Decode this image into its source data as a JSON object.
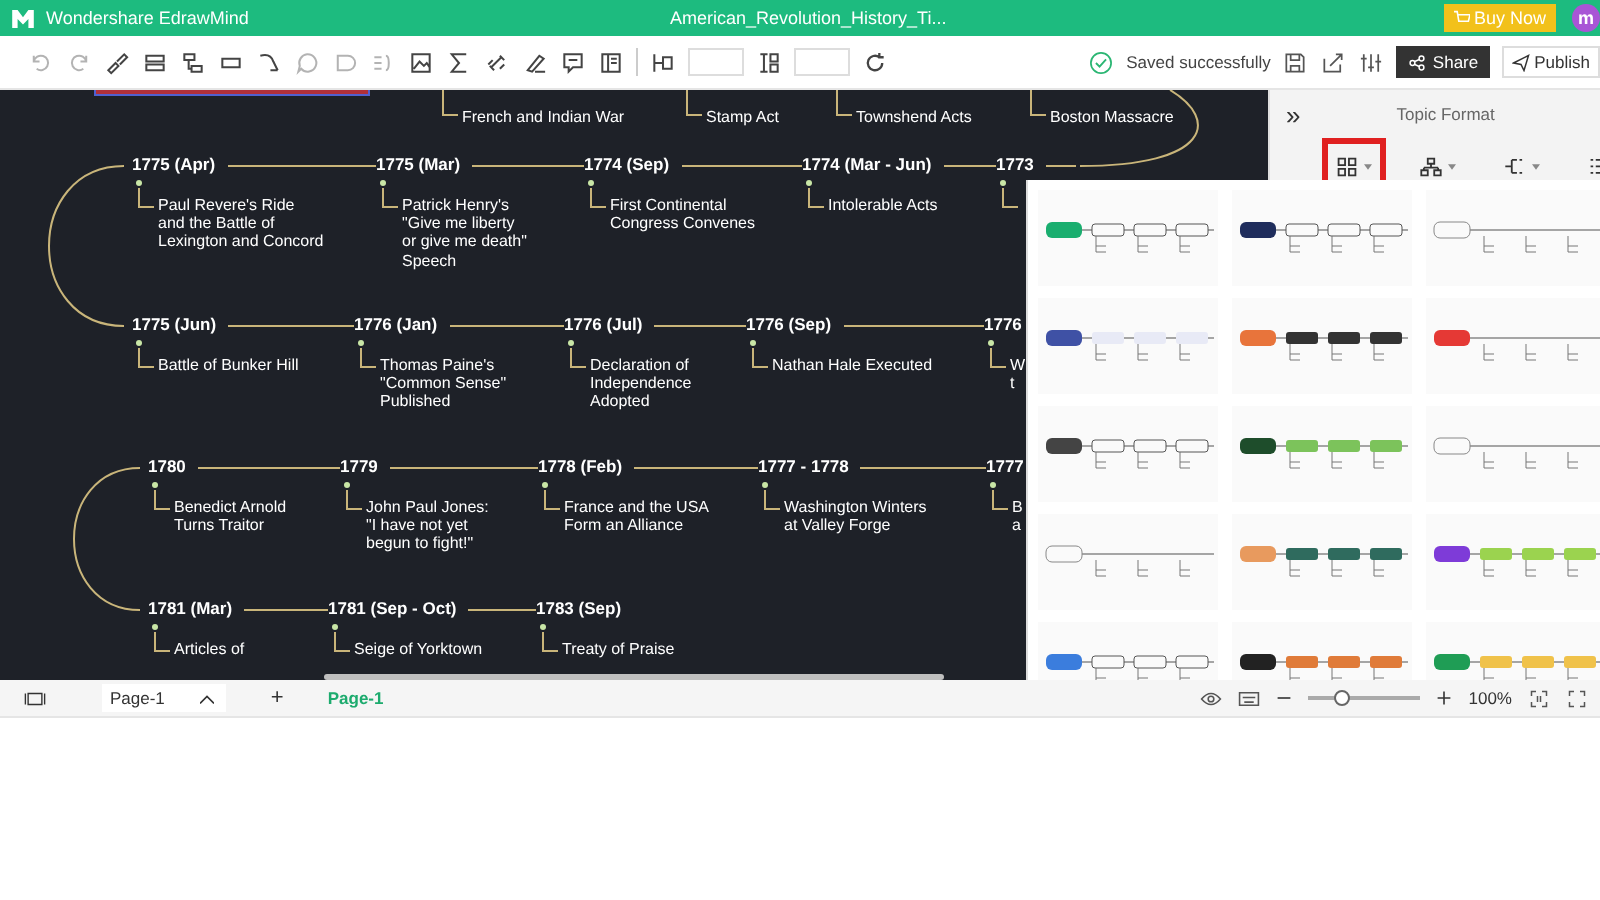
{
  "app": {
    "name": "Wondershare EdrawMind",
    "document_title": "American_Revolution_History_Ti...",
    "buy_button": "Buy Now",
    "avatar": "m"
  },
  "toolbar": {
    "save_status": "Saved successfully",
    "share": "Share",
    "publish": "Publish"
  },
  "canvas": {
    "top_topics": [
      "French and Indian War",
      "Stamp Act",
      "Townshend Acts",
      "Boston Massacre"
    ],
    "rows": [
      {
        "nodes": [
          {
            "date": "1775 (Apr)",
            "topic": "Paul Revere's Ride\nand the Battle of\nLexington and Concord"
          },
          {
            "date": "1775 (Mar)",
            "topic": "Patrick Henry's\n\"Give me liberty\nor give me death\"\nSpeech"
          },
          {
            "date": "1774 (Sep)",
            "topic": "First Continental\nCongress Convenes"
          },
          {
            "date": "1774 (Mar - Jun)",
            "topic": "Intolerable Acts"
          },
          {
            "date": "1773"
          }
        ]
      },
      {
        "nodes": [
          {
            "date": "1775 (Jun)",
            "topic": "Battle of Bunker Hill"
          },
          {
            "date": "1776 (Jan)",
            "topic": "Thomas Paine's\n\"Common Sense\"\nPublished"
          },
          {
            "date": "1776 (Jul)",
            "topic": "Declaration of\nIndependence\nAdopted"
          },
          {
            "date": "1776 (Sep)",
            "topic": "Nathan Hale Executed"
          },
          {
            "date": "1776",
            "topic": "W\nt"
          }
        ]
      },
      {
        "nodes": [
          {
            "date": "1780",
            "topic": "Benedict Arnold\nTurns Traitor"
          },
          {
            "date": "1779",
            "topic": "John Paul Jones:\n\"I have not yet\nbegun to fight!\""
          },
          {
            "date": "1778 (Feb)",
            "topic": "France and the USA\nForm an Alliance"
          },
          {
            "date": "1777 - 1778",
            "topic": "Washington Winters\nat Valley Forge"
          },
          {
            "date": "1777",
            "topic": "B\na"
          }
        ]
      },
      {
        "nodes": [
          {
            "date": "1781 (Mar)",
            "topic": "Articles of"
          },
          {
            "date": "1781 (Sep - Oct)",
            "topic": "Seige of Yorktown"
          },
          {
            "date": "1783 (Sep)",
            "topic": "Treaty of Praise"
          }
        ]
      }
    ]
  },
  "panel": {
    "collapse": "»",
    "title": "Topic Format",
    "tools": [
      {
        "selected": true
      },
      {
        "selected": false
      },
      {
        "selected": false
      },
      {
        "selected": false
      }
    ]
  },
  "templates": [
    {
      "kind": "outline",
      "color": "#1aae6f"
    },
    {
      "kind": "outline",
      "color": "#1f2d5c"
    },
    {
      "kind": "plain"
    },
    {
      "kind": "filled",
      "color": "#3f51a5",
      "topic": {
        "color": "#e8eaf6"
      }
    },
    {
      "kind": "filled",
      "color": "#e8743b",
      "topic": {
        "color": "#333333"
      }
    },
    {
      "kind": "plain",
      "color": "#e53935"
    },
    {
      "kind": "outline",
      "color": "#444444"
    },
    {
      "kind": "filled",
      "color": "#1e4d2b",
      "topic": {
        "color": "#7cc35b"
      }
    },
    {
      "kind": "plain"
    },
    {
      "kind": "plain"
    },
    {
      "kind": "filled",
      "color": "#e89a5e",
      "topic": {
        "color": "#2f6b5e"
      }
    },
    {
      "kind": "filled",
      "color": "#7e3bd8",
      "topic": {
        "color": "#9bd34f"
      }
    },
    {
      "kind": "outline",
      "color": "#3b7ddd"
    },
    {
      "kind": "filled",
      "color": "#222222",
      "topic": {
        "color": "#e07b39"
      }
    },
    {
      "kind": "filled",
      "color": "#1f9d55",
      "topic": {
        "color": "#f0c24a"
      }
    }
  ],
  "status_bar": {
    "page_select": "Page-1",
    "add": "+",
    "pages": [
      {
        "label": "Page-1",
        "selected": true
      }
    ],
    "zoom_slider": {
      "level": 0.3
    },
    "zoom": "100%"
  }
}
